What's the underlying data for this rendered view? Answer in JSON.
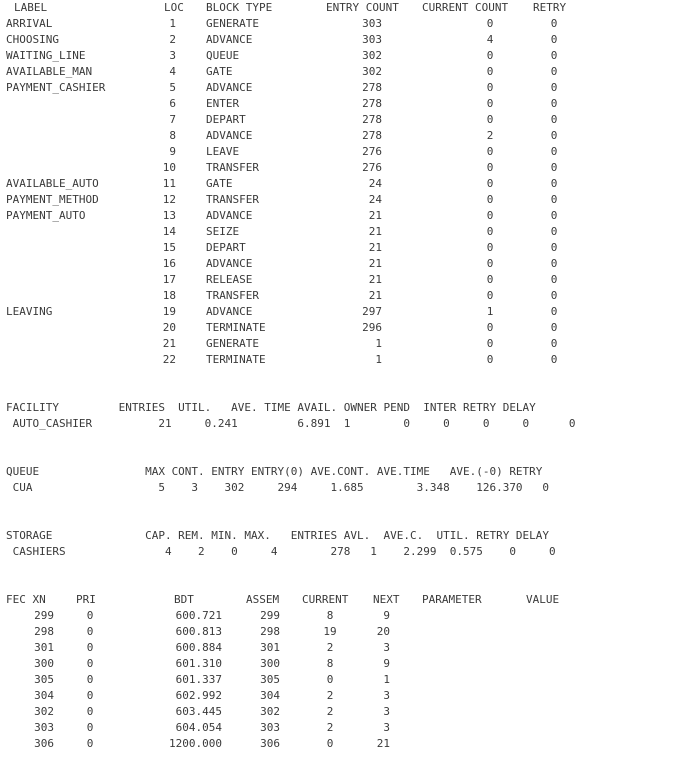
{
  "block_table": {
    "headers": {
      "label": "LABEL",
      "loc": "LOC",
      "block_type": "BLOCK TYPE",
      "entry_count": "ENTRY COUNT",
      "current_count": "CURRENT COUNT",
      "retry": "RETRY"
    },
    "rows": [
      {
        "label": "ARRIVAL",
        "loc": "1",
        "type": "GENERATE",
        "entry": "303",
        "current": "0",
        "retry": "0"
      },
      {
        "label": "CHOOSING",
        "loc": "2",
        "type": "ADVANCE",
        "entry": "303",
        "current": "4",
        "retry": "0"
      },
      {
        "label": "WAITING_LINE",
        "loc": "3",
        "type": "QUEUE",
        "entry": "302",
        "current": "0",
        "retry": "0"
      },
      {
        "label": "AVAILABLE_MAN",
        "loc": "4",
        "type": "GATE",
        "entry": "302",
        "current": "0",
        "retry": "0"
      },
      {
        "label": "PAYMENT_CASHIER",
        "loc": "5",
        "type": "ADVANCE",
        "entry": "278",
        "current": "0",
        "retry": "0"
      },
      {
        "label": "",
        "loc": "6",
        "type": "ENTER",
        "entry": "278",
        "current": "0",
        "retry": "0"
      },
      {
        "label": "",
        "loc": "7",
        "type": "DEPART",
        "entry": "278",
        "current": "0",
        "retry": "0"
      },
      {
        "label": "",
        "loc": "8",
        "type": "ADVANCE",
        "entry": "278",
        "current": "2",
        "retry": "0"
      },
      {
        "label": "",
        "loc": "9",
        "type": "LEAVE",
        "entry": "276",
        "current": "0",
        "retry": "0"
      },
      {
        "label": "",
        "loc": "10",
        "type": "TRANSFER",
        "entry": "276",
        "current": "0",
        "retry": "0"
      },
      {
        "label": "AVAILABLE_AUTO",
        "loc": "11",
        "type": "GATE",
        "entry": "24",
        "current": "0",
        "retry": "0"
      },
      {
        "label": "PAYMENT_METHOD",
        "loc": "12",
        "type": "TRANSFER",
        "entry": "24",
        "current": "0",
        "retry": "0"
      },
      {
        "label": "PAYMENT_AUTO",
        "loc": "13",
        "type": "ADVANCE",
        "entry": "21",
        "current": "0",
        "retry": "0"
      },
      {
        "label": "",
        "loc": "14",
        "type": "SEIZE",
        "entry": "21",
        "current": "0",
        "retry": "0"
      },
      {
        "label": "",
        "loc": "15",
        "type": "DEPART",
        "entry": "21",
        "current": "0",
        "retry": "0"
      },
      {
        "label": "",
        "loc": "16",
        "type": "ADVANCE",
        "entry": "21",
        "current": "0",
        "retry": "0"
      },
      {
        "label": "",
        "loc": "17",
        "type": "RELEASE",
        "entry": "21",
        "current": "0",
        "retry": "0"
      },
      {
        "label": "",
        "loc": "18",
        "type": "TRANSFER",
        "entry": "21",
        "current": "0",
        "retry": "0"
      },
      {
        "label": "LEAVING",
        "loc": "19",
        "type": "ADVANCE",
        "entry": "297",
        "current": "1",
        "retry": "0"
      },
      {
        "label": "",
        "loc": "20",
        "type": "TERMINATE",
        "entry": "296",
        "current": "0",
        "retry": "0"
      },
      {
        "label": "",
        "loc": "21",
        "type": "GENERATE",
        "entry": "1",
        "current": "0",
        "retry": "0"
      },
      {
        "label": "",
        "loc": "22",
        "type": "TERMINATE",
        "entry": "1",
        "current": "0",
        "retry": "0"
      }
    ]
  },
  "facility": {
    "header": "FACILITY         ENTRIES  UTIL.   AVE. TIME AVAIL. OWNER PEND  INTER RETRY DELAY",
    "row": " AUTO_CASHIER          21     0.241         6.891  1        0     0     0     0      0"
  },
  "queue": {
    "header": "QUEUE                MAX CONT. ENTRY ENTRY(0) AVE.CONT. AVE.TIME   AVE.(-0) RETRY",
    "row": " CUA                   5    3    302     294     1.685        3.348    126.370   0"
  },
  "storage": {
    "header": "STORAGE              CAP. REM. MIN. MAX.   ENTRIES AVL.  AVE.C.  UTIL. RETRY DELAY",
    "row": " CASHIERS               4    2    0     4        278   1    2.299  0.575    0     0"
  },
  "fec": {
    "headers": {
      "xn": "FEC XN",
      "pri": "PRI",
      "bdt": "BDT",
      "assem": "ASSEM",
      "current": "CURRENT",
      "next": "NEXT",
      "parameter": "PARAMETER",
      "value": "VALUE"
    },
    "rows": [
      {
        "xn": "299",
        "pri": "0",
        "bdt": "600.721",
        "assem": "299",
        "current": "8",
        "next": "9"
      },
      {
        "xn": "298",
        "pri": "0",
        "bdt": "600.813",
        "assem": "298",
        "current": "19",
        "next": "20"
      },
      {
        "xn": "301",
        "pri": "0",
        "bdt": "600.884",
        "assem": "301",
        "current": "2",
        "next": "3"
      },
      {
        "xn": "300",
        "pri": "0",
        "bdt": "601.310",
        "assem": "300",
        "current": "8",
        "next": "9"
      },
      {
        "xn": "305",
        "pri": "0",
        "bdt": "601.337",
        "assem": "305",
        "current": "0",
        "next": "1"
      },
      {
        "xn": "304",
        "pri": "0",
        "bdt": "602.992",
        "assem": "304",
        "current": "2",
        "next": "3"
      },
      {
        "xn": "302",
        "pri": "0",
        "bdt": "603.445",
        "assem": "302",
        "current": "2",
        "next": "3"
      },
      {
        "xn": "303",
        "pri": "0",
        "bdt": "604.054",
        "assem": "303",
        "current": "2",
        "next": "3"
      },
      {
        "xn": "306",
        "pri": "0",
        "bdt": "1200.000",
        "assem": "306",
        "current": "0",
        "next": "21"
      }
    ]
  }
}
